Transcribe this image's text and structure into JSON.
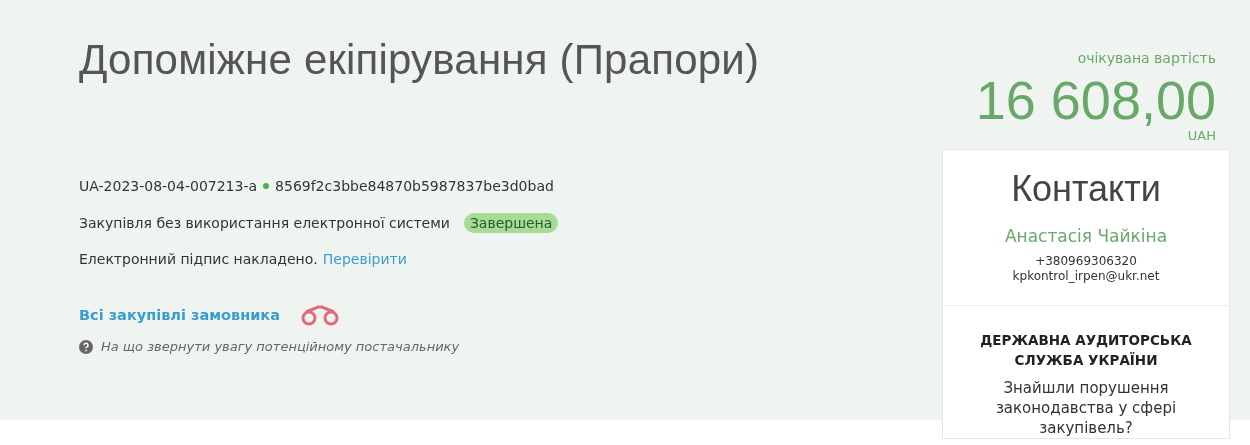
{
  "title": "Допоміжне екіпірування (Прапори)",
  "tender_id": "UA-2023-08-04-007213-a",
  "hash": "8569f2c3bbe84870b5987837be3d0bad",
  "procedure": "Закупівля без використання електронної системи",
  "status": {
    "label": "Завершена",
    "color": "#a6dc98"
  },
  "signature": {
    "text": "Електронний підпис накладено.",
    "link": "Перевірити"
  },
  "customer_link": "Всі закупівлі замовника",
  "hint": "На що звернути увагу потенційному постачальнику",
  "value": {
    "label": "очікувана вартість",
    "amount": "16 608,00",
    "currency": "UAH"
  },
  "contacts": {
    "title": "Контакти",
    "name": "Анастасія Чайкіна",
    "phone": "+380969306320",
    "email": "kpkontrol_irpen@ukr.net"
  },
  "audit": {
    "title": "ДЕРЖАВНА АУДИТОРСЬКА СЛУЖБА УКРАЇНИ",
    "text": "Знайшли порушення законодавства у сфері закупівель?"
  }
}
